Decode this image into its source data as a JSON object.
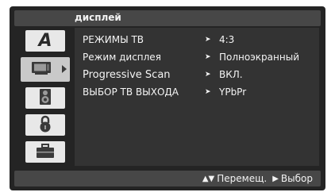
{
  "header": {
    "title": "дисплей"
  },
  "sidebar": {
    "items": [
      {
        "icon": "letter-a-icon",
        "glyph": "A"
      },
      {
        "icon": "tv-display-icon",
        "selected": true
      },
      {
        "icon": "speaker-icon"
      },
      {
        "icon": "lock-icon"
      },
      {
        "icon": "briefcase-icon"
      }
    ]
  },
  "settings": [
    {
      "label": "РЕЖИМЫ ТВ",
      "value": "4:3"
    },
    {
      "label": "Режим дисплея",
      "value": "Полноэкранный"
    },
    {
      "label": "Progressive Scan",
      "value": "ВКЛ."
    },
    {
      "label": "ВЫБОР ТВ ВЫХОДА",
      "value": "YPbPr"
    }
  ],
  "footer": {
    "move_label": "Перемещ.",
    "select_label": "Выбор"
  },
  "colors": {
    "screen_bg": "#242424",
    "panel_bg": "#333333",
    "bar_bg": "#474747",
    "text": "#f4f4f4"
  }
}
